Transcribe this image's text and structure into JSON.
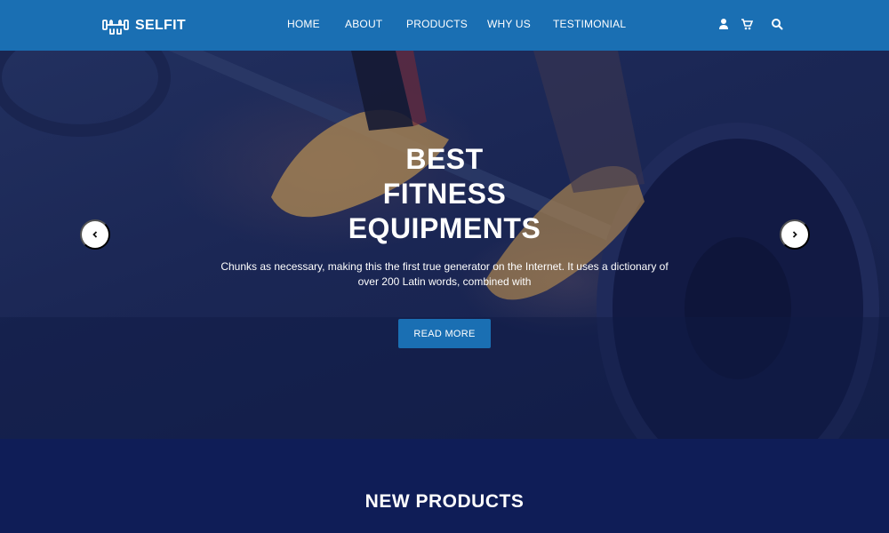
{
  "brand": {
    "name": "SELFIT",
    "logo_icon": "dumbbell-hands-icon"
  },
  "nav": {
    "items": [
      {
        "label": "HOME"
      },
      {
        "label": "ABOUT"
      },
      {
        "label": "PRODUCTS"
      },
      {
        "label": "WHY US"
      },
      {
        "label": "TESTIMONIAL"
      }
    ],
    "icons": [
      "user-icon",
      "cart-icon",
      "search-icon"
    ]
  },
  "hero": {
    "title_lines": [
      "BEST",
      "FITNESS",
      "EQUIPMENTS"
    ],
    "description": "Chunks as necessary, making this the first true generator on the Internet. It uses a dictionary of over 200 Latin words, combined with",
    "button_label": "READ MORE",
    "prev_icon": "chevron-left-icon",
    "next_icon": "chevron-right-icon"
  },
  "products": {
    "heading": "NEW PRODUCTS"
  },
  "colors": {
    "accent": "#1a6fb3",
    "navy": "#0f1d57",
    "white": "#ffffff"
  }
}
